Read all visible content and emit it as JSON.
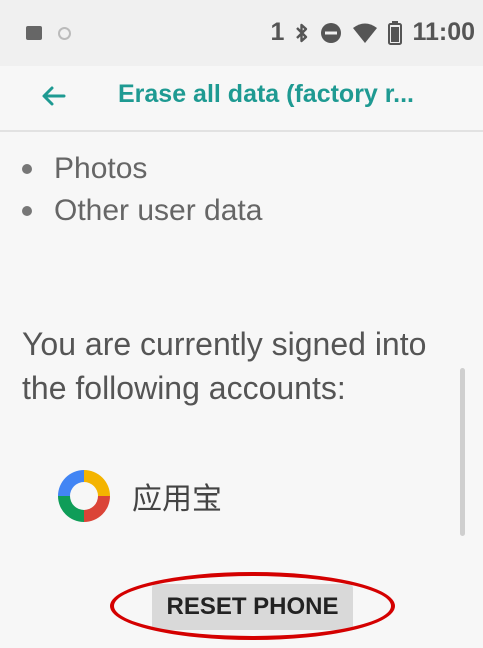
{
  "status_bar": {
    "left_icons": [
      "image-icon",
      "circle-icon"
    ],
    "sim_indicator": "1",
    "right_icons": [
      "bluetooth-icon",
      "dnd-icon",
      "wifi-icon",
      "battery-icon"
    ],
    "time": "11:00"
  },
  "app_bar": {
    "back_icon": "back-arrow-icon",
    "title": "Erase all data (factory r..."
  },
  "content": {
    "bullets": [
      "Photos",
      "Other user data"
    ],
    "signed_in_text": "You are currently signed into the following accounts:",
    "account": {
      "icon": "app-logo-icon",
      "name": "应用宝"
    }
  },
  "actions": {
    "reset_label": "RESET PHONE"
  },
  "colors": {
    "accent": "#1e9a92",
    "highlight": "#d40000",
    "button_bg": "#d9d9d9"
  }
}
